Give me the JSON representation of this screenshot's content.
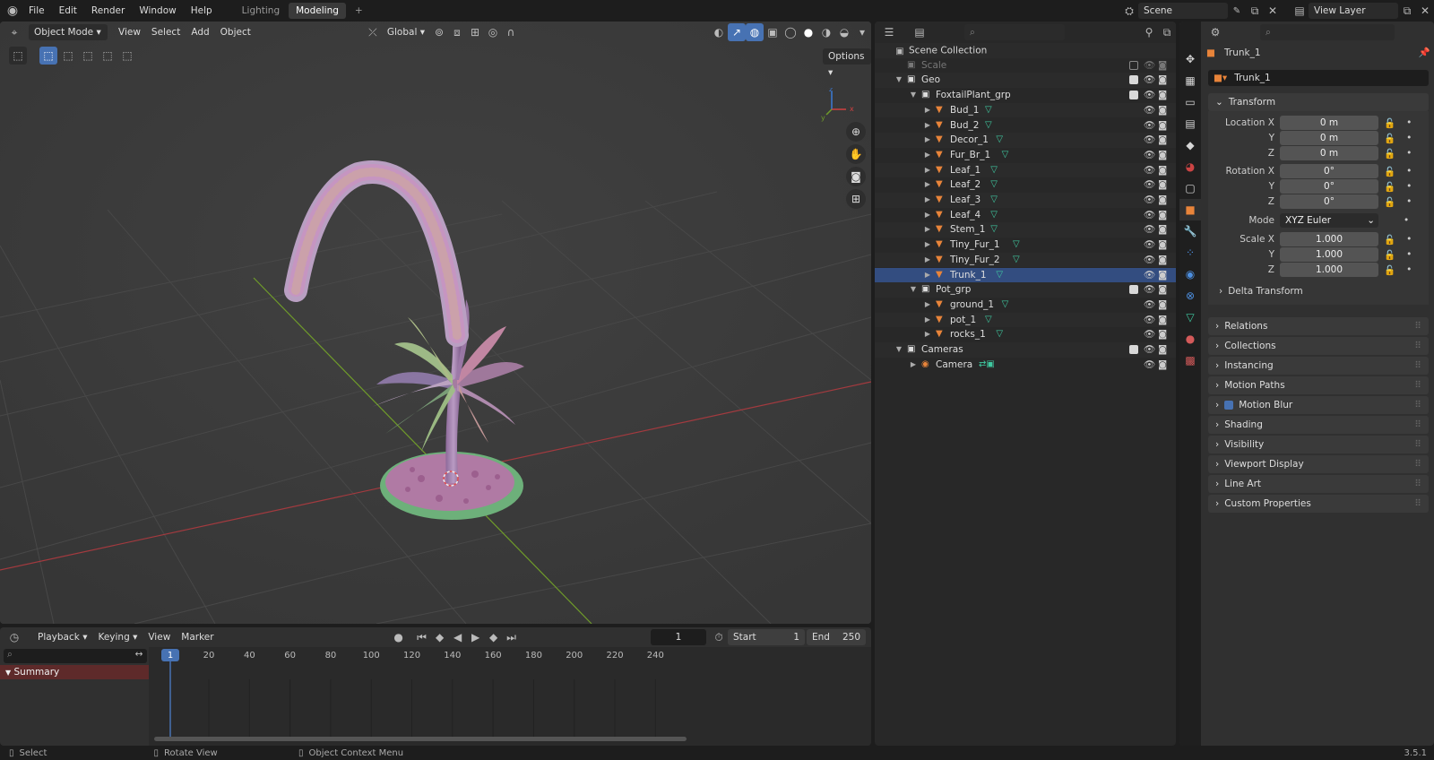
{
  "menu": {
    "file": "File",
    "edit": "Edit",
    "render": "Render",
    "window": "Window",
    "help": "Help"
  },
  "workspaces": {
    "lighting": "Lighting",
    "modeling": "Modeling",
    "add": "+"
  },
  "scene": {
    "name": "Scene",
    "view_layer": "View Layer"
  },
  "viewport_header": {
    "mode": "Object Mode",
    "view": "View",
    "select": "Select",
    "add": "Add",
    "object": "Object",
    "orientation": "Global",
    "options": "Options"
  },
  "gizmo": {
    "x": "x",
    "y": "y",
    "z": "z"
  },
  "outliner": {
    "search_placeholder": "",
    "root": "Scene Collection",
    "rows": [
      {
        "label": "Scale",
        "indent": 1,
        "kind": "collection",
        "disabled": true
      },
      {
        "label": "Geo",
        "indent": 1,
        "kind": "collection",
        "expanded": true
      },
      {
        "label": "FoxtailPlant_grp",
        "indent": 2,
        "kind": "collection",
        "expanded": true
      },
      {
        "label": "Bud_1",
        "indent": 3,
        "kind": "mesh"
      },
      {
        "label": "Bud_2",
        "indent": 3,
        "kind": "mesh"
      },
      {
        "label": "Decor_1",
        "indent": 3,
        "kind": "mesh"
      },
      {
        "label": "Fur_Br_1",
        "indent": 3,
        "kind": "mesh"
      },
      {
        "label": "Leaf_1",
        "indent": 3,
        "kind": "mesh"
      },
      {
        "label": "Leaf_2",
        "indent": 3,
        "kind": "mesh"
      },
      {
        "label": "Leaf_3",
        "indent": 3,
        "kind": "mesh"
      },
      {
        "label": "Leaf_4",
        "indent": 3,
        "kind": "mesh"
      },
      {
        "label": "Stem_1",
        "indent": 3,
        "kind": "mesh"
      },
      {
        "label": "Tiny_Fur_1",
        "indent": 3,
        "kind": "mesh"
      },
      {
        "label": "Tiny_Fur_2",
        "indent": 3,
        "kind": "mesh"
      },
      {
        "label": "Trunk_1",
        "indent": 3,
        "kind": "mesh",
        "active": true
      },
      {
        "label": "Pot_grp",
        "indent": 2,
        "kind": "collection",
        "expanded": true
      },
      {
        "label": "ground_1",
        "indent": 3,
        "kind": "mesh"
      },
      {
        "label": "pot_1",
        "indent": 3,
        "kind": "mesh"
      },
      {
        "label": "rocks_1",
        "indent": 3,
        "kind": "mesh"
      },
      {
        "label": "Cameras",
        "indent": 1,
        "kind": "collection",
        "expanded": true
      },
      {
        "label": "Camera",
        "indent": 2,
        "kind": "camera"
      }
    ]
  },
  "properties": {
    "object_name": "Trunk_1",
    "datablock": "Trunk_1",
    "transform": "Transform",
    "location": {
      "x_label": "Location X",
      "y_label": "Y",
      "z_label": "Z",
      "x": "0 m",
      "y": "0 m",
      "z": "0 m"
    },
    "rotation": {
      "x_label": "Rotation X",
      "y_label": "Y",
      "z_label": "Z",
      "x": "0°",
      "y": "0°",
      "z": "0°"
    },
    "mode_label": "Mode",
    "mode_value": "XYZ Euler",
    "scale": {
      "x_label": "Scale X",
      "y_label": "Y",
      "z_label": "Z",
      "x": "1.000",
      "y": "1.000",
      "z": "1.000"
    },
    "delta": "Delta Transform",
    "panels": [
      "Relations",
      "Collections",
      "Instancing",
      "Motion Paths",
      "Motion Blur",
      "Shading",
      "Visibility",
      "Viewport Display",
      "Line Art",
      "Custom Properties"
    ]
  },
  "timeline": {
    "playback": "Playback",
    "keying": "Keying",
    "view": "View",
    "marker": "Marker",
    "current_frame": "1",
    "start_label": "Start",
    "start": "1",
    "end_label": "End",
    "end": "250",
    "summary": "Summary",
    "ticks": [
      "1",
      "20",
      "40",
      "60",
      "80",
      "100",
      "120",
      "140",
      "160",
      "180",
      "200",
      "220",
      "240"
    ]
  },
  "status": {
    "select": "Select",
    "rotate": "Rotate View",
    "context": "Object Context Menu",
    "version": "3.5.1"
  },
  "colors": {
    "accent": "#4772b3",
    "mesh_orange": "#e8843a",
    "mesh_data_green": "#3fc9a0",
    "x_axis": "#b8363b",
    "y_axis": "#6e9a2a",
    "timeline_summary": "#5e2a2a"
  }
}
